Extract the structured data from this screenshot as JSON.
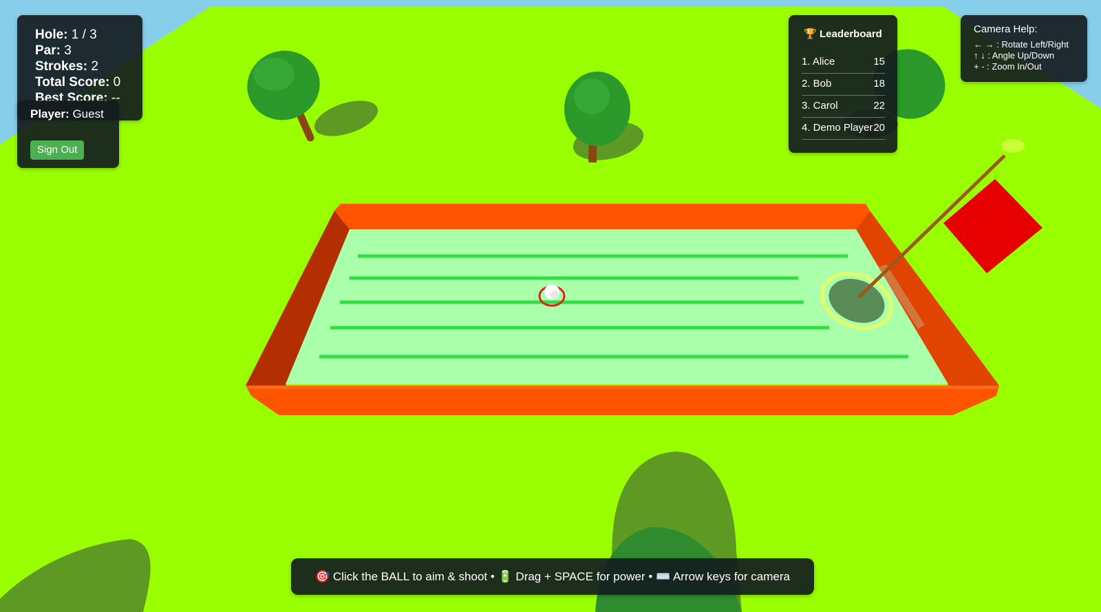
{
  "stats": {
    "hole_label": "Hole:",
    "hole_value": "1 / 3",
    "par_label": "Par:",
    "par_value": "3",
    "strokes_label": "Strokes:",
    "strokes_value": "2",
    "total_label": "Total Score:",
    "total_value": "0",
    "best_label": "Best Score:",
    "best_value": "--"
  },
  "player": {
    "label": "Player:",
    "name": "Guest",
    "sign_out_label": "Sign Out"
  },
  "leaderboard": {
    "title": "🏆 Leaderboard",
    "entries": [
      {
        "name": "1. Alice",
        "score": "15"
      },
      {
        "name": "2. Bob",
        "score": "18"
      },
      {
        "name": "3. Carol",
        "score": "22"
      },
      {
        "name": "4. Demo Player",
        "score": "20"
      }
    ]
  },
  "camera_help": {
    "title": "Camera Help:",
    "lines": [
      "← → : Rotate Left/Right",
      "↑ ↓ : Angle Up/Down",
      "+ - : Zoom In/Out"
    ]
  },
  "hint": {
    "text": "🎯 Click the BALL to aim & shoot • 🔋 Drag + SPACE for power • ⌨️ Arrow keys for camera"
  },
  "colors": {
    "grass": "#99ff00",
    "sky": "#87ceeb",
    "course_wall": "#ff5500",
    "course_surface": "#aaffaa",
    "flag": "#e60000",
    "panel_bg": "#141c1e",
    "sign_out_button": "#4caf50"
  }
}
